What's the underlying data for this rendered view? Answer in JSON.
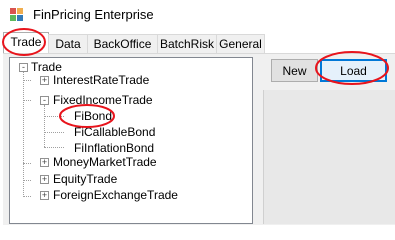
{
  "window": {
    "title": "FinPricing Enterprise",
    "icon": "app-window-icon"
  },
  "tabs": [
    {
      "label": "Trade",
      "active": true
    },
    {
      "label": "Data",
      "active": false
    },
    {
      "label": "BackOffice",
      "active": false
    },
    {
      "label": "BatchRisk",
      "active": false
    },
    {
      "label": "General",
      "active": false
    }
  ],
  "tree": {
    "root": "Trade",
    "items": [
      {
        "label": "InterestRateTrade",
        "expander": "+"
      },
      {
        "label": "FixedIncomeTrade",
        "expander": "-"
      },
      {
        "label": "FiBond"
      },
      {
        "label": "FiCallableBond"
      },
      {
        "label": "FiInflationBond"
      },
      {
        "label": "MoneyMarketTrade",
        "expander": "+"
      },
      {
        "label": "EquityTrade",
        "expander": "+"
      },
      {
        "label": "ForeignExchangeTrade",
        "expander": "+"
      }
    ],
    "root_expander": "-"
  },
  "buttons": {
    "new_label": "New",
    "load_label": "Load"
  },
  "colors": {
    "annotation": "#e8141c",
    "accent": "#0078d7"
  }
}
